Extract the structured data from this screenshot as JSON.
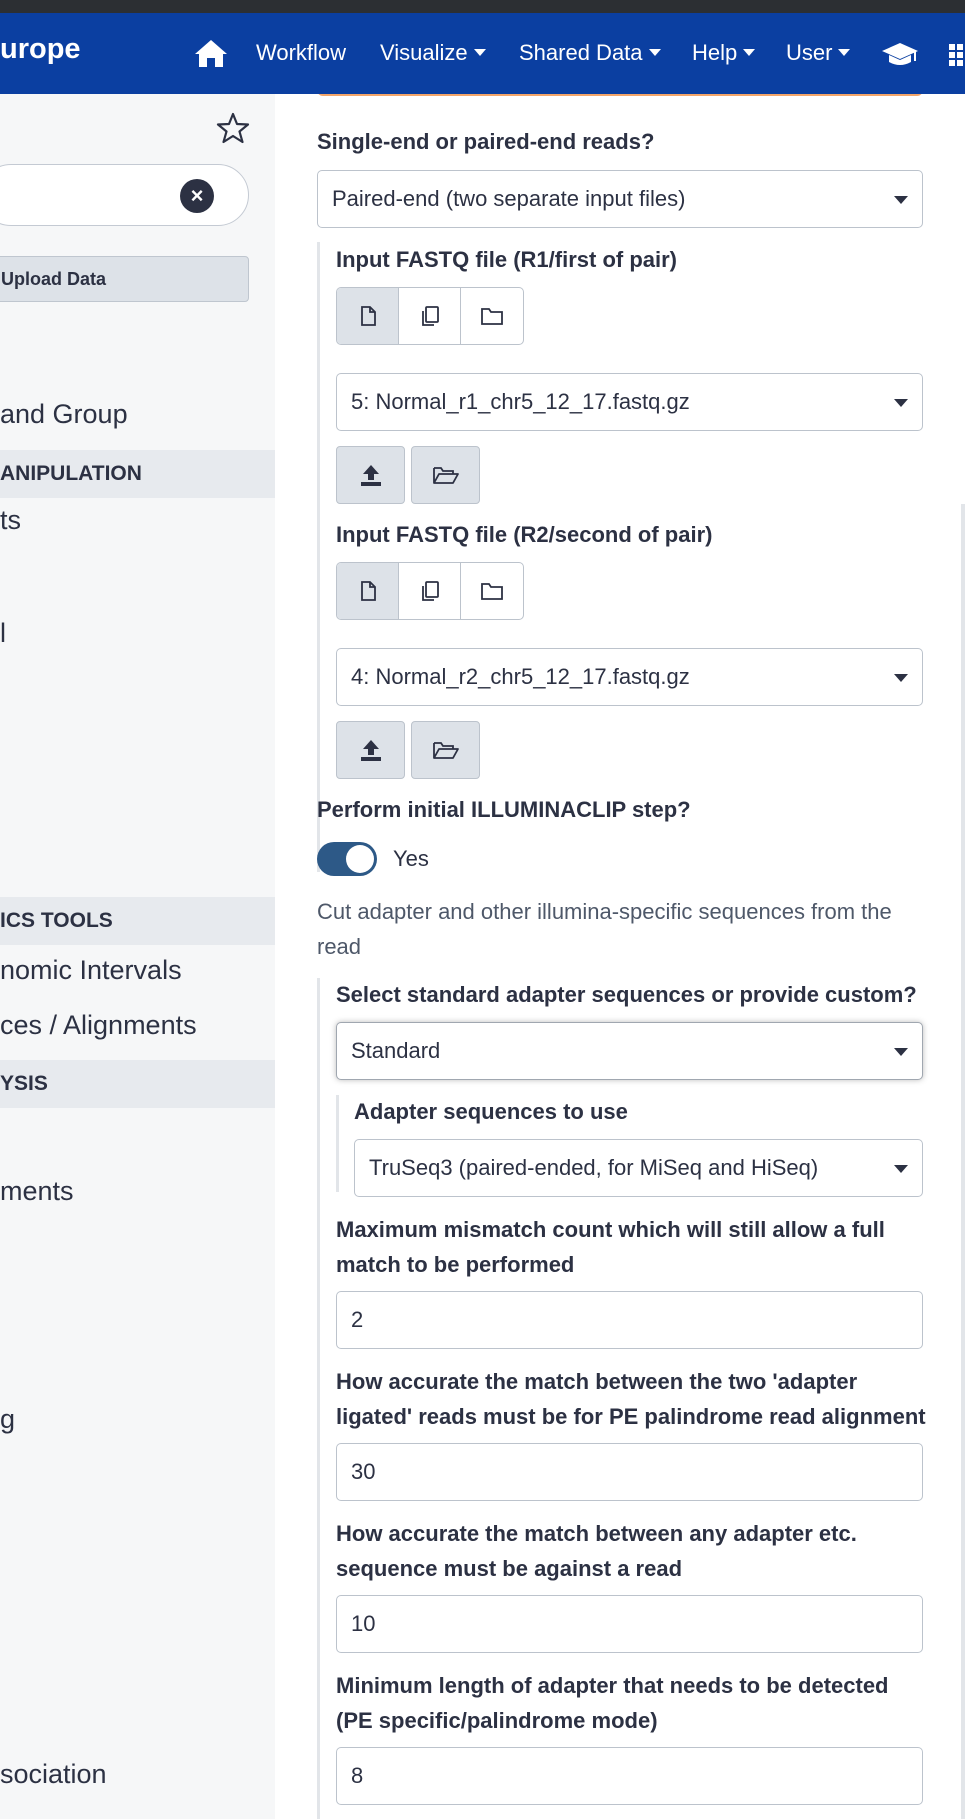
{
  "navbar": {
    "brand": "urope",
    "items": [
      {
        "label": "Workflow",
        "dropdown": false
      },
      {
        "label": "Visualize",
        "dropdown": true
      },
      {
        "label": "Shared Data",
        "dropdown": true
      },
      {
        "label": "Help",
        "dropdown": true
      },
      {
        "label": "User",
        "dropdown": true
      }
    ],
    "icons": [
      "home-icon",
      "graduation-cap-icon",
      "grid-icon"
    ]
  },
  "tool_panel": {
    "upload_label": "Upload Data",
    "links": [
      "and Group",
      "ts",
      "l",
      "nomic Intervals",
      "ces / Alignments",
      "ments",
      "g",
      "sociation"
    ],
    "sections": [
      "ANIPULATION",
      "ICS TOOLS",
      "YSIS"
    ]
  },
  "form": {
    "reads_label": "Single-end or paired-end reads?",
    "reads_value": "Paired-end (two separate input files)",
    "r1_label": "Input FASTQ file (R1/first of pair)",
    "r1_value": "5: Normal_r1_chr5_12_17.fastq.gz",
    "r2_label": "Input FASTQ file (R2/second of pair)",
    "r2_value": "4: Normal_r2_chr5_12_17.fastq.gz",
    "illuminaclip_label": "Perform initial ILLUMINACLIP step?",
    "illuminaclip_toggle": "Yes",
    "illuminaclip_help": "Cut adapter and other illumina-specific sequences from the read",
    "adapter_source_label": "Select standard adapter sequences or provide custom?",
    "adapter_source_value": "Standard",
    "adapter_seq_label": "Adapter sequences to use",
    "adapter_seq_value": "TruSeq3 (paired-ended, for MiSeq and HiSeq)",
    "mismatch_label": "Maximum mismatch count which will still allow a full match to be performed",
    "mismatch_value": "2",
    "palindrome_label": "How accurate the match between the two 'adapter ligated' reads must be for PE palindrome read alignment",
    "palindrome_value": "30",
    "simple_label": "How accurate the match between any adapter etc. sequence must be against a read",
    "simple_value": "10",
    "minlen_label": "Minimum length of adapter that needs to be detected (PE specific/palindrome mode)",
    "minlen_value": "8"
  },
  "colors": {
    "navbar": "#0b3fa1",
    "toggle_on": "#2d5987",
    "warning_strip": "#f3a56a"
  }
}
